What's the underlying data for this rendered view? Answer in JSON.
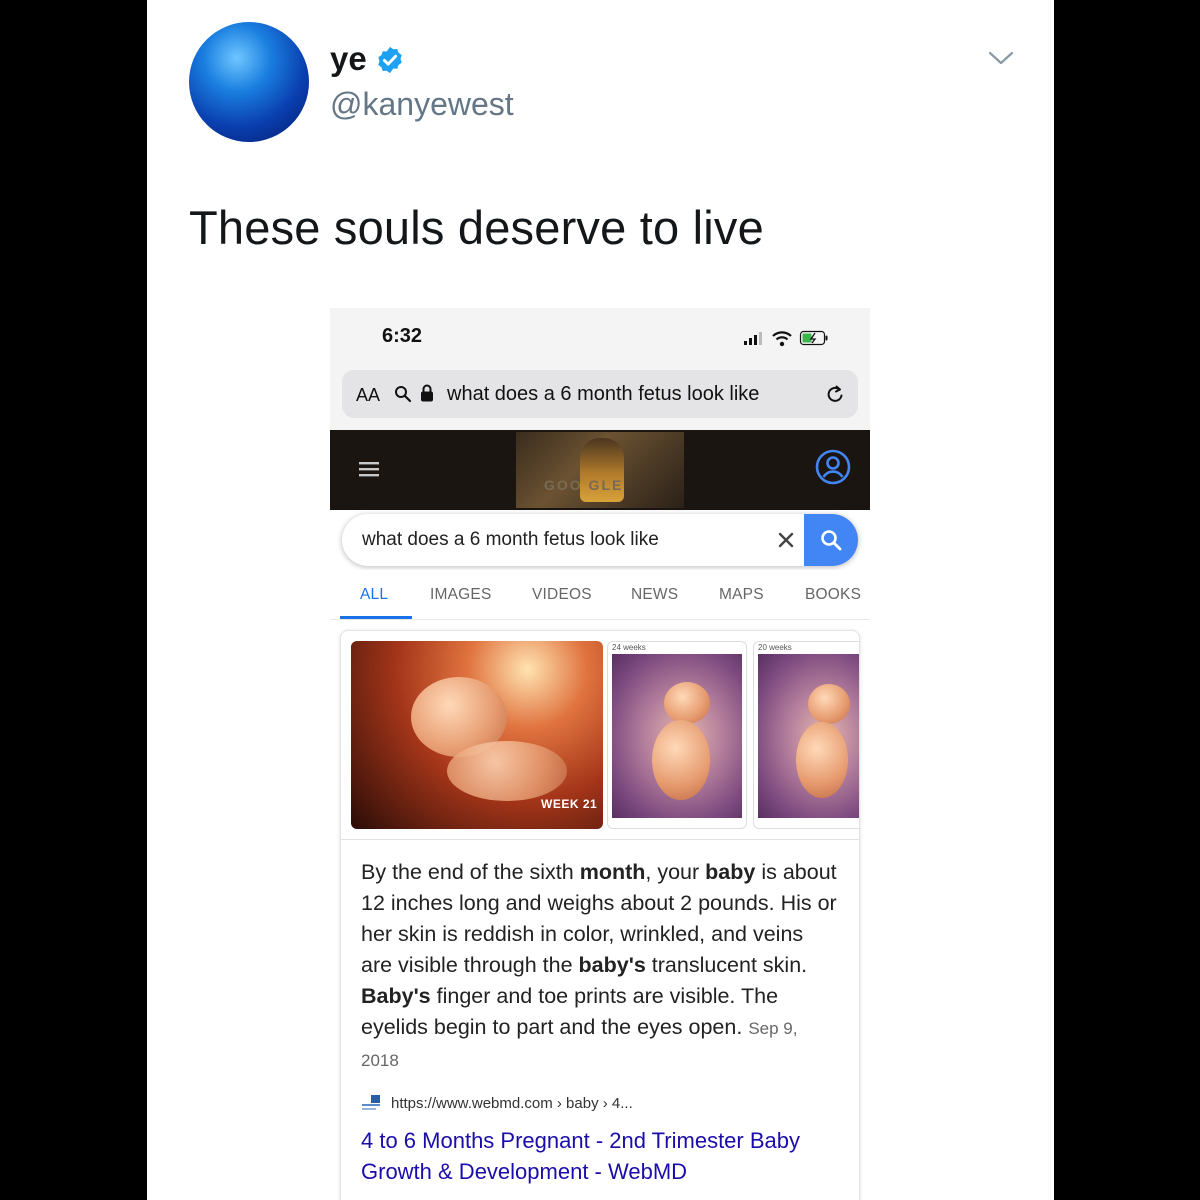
{
  "tweet": {
    "display_name": "ye",
    "handle": "@kanyewest",
    "text": "These souls deserve to live",
    "verified": true
  },
  "phone": {
    "status": {
      "time": "6:32"
    },
    "address_bar": {
      "aa_label": "AA",
      "url_text": "what does a 6 month fetus look like"
    },
    "search": {
      "query": "what does a 6 month fetus look like"
    },
    "tabs": [
      {
        "label": "ALL",
        "active": true
      },
      {
        "label": "IMAGES",
        "active": false
      },
      {
        "label": "VIDEOS",
        "active": false
      },
      {
        "label": "NEWS",
        "active": false
      },
      {
        "label": "MAPS",
        "active": false
      },
      {
        "label": "BOOKS",
        "active": false
      }
    ],
    "images": {
      "week_label": "WEEK 21",
      "thumb_2_caption": "24 weeks",
      "thumb_3_caption": "20 weeks"
    },
    "result": {
      "snippet_runs": [
        {
          "t": "By the end of the sixth ",
          "b": false
        },
        {
          "t": "month",
          "b": true
        },
        {
          "t": ", your ",
          "b": false
        },
        {
          "t": "baby",
          "b": true
        },
        {
          "t": " is about 12 inches long and weighs about 2 pounds. His or her skin is reddish in color, wrinkled, and veins are visible through the ",
          "b": false
        },
        {
          "t": "baby's",
          "b": true
        },
        {
          "t": " translucent skin. ",
          "b": false
        },
        {
          "t": "Baby's",
          "b": true
        },
        {
          "t": " finger and toe prints are visible. The eyelids begin to part and the eyes open.",
          "b": false
        }
      ],
      "date": "Sep 9, 2018",
      "source_url": "https://www.webmd.com › baby › 4...",
      "title": "4 to 6 Months Pregnant - 2nd Trimester Baby Growth & Development - WebMD"
    }
  },
  "colors": {
    "link_blue": "#1a0dab",
    "google_blue": "#4285f4",
    "verified_blue": "#1da1f2",
    "tab_active": "#1a73e8"
  },
  "icons": [
    "verified-badge-icon",
    "chevron-down-icon",
    "signal-icon",
    "wifi-icon",
    "battery-icon",
    "search-icon",
    "lock-icon",
    "reload-icon",
    "menu-icon",
    "account-icon",
    "clear-icon",
    "favicon-icon"
  ]
}
